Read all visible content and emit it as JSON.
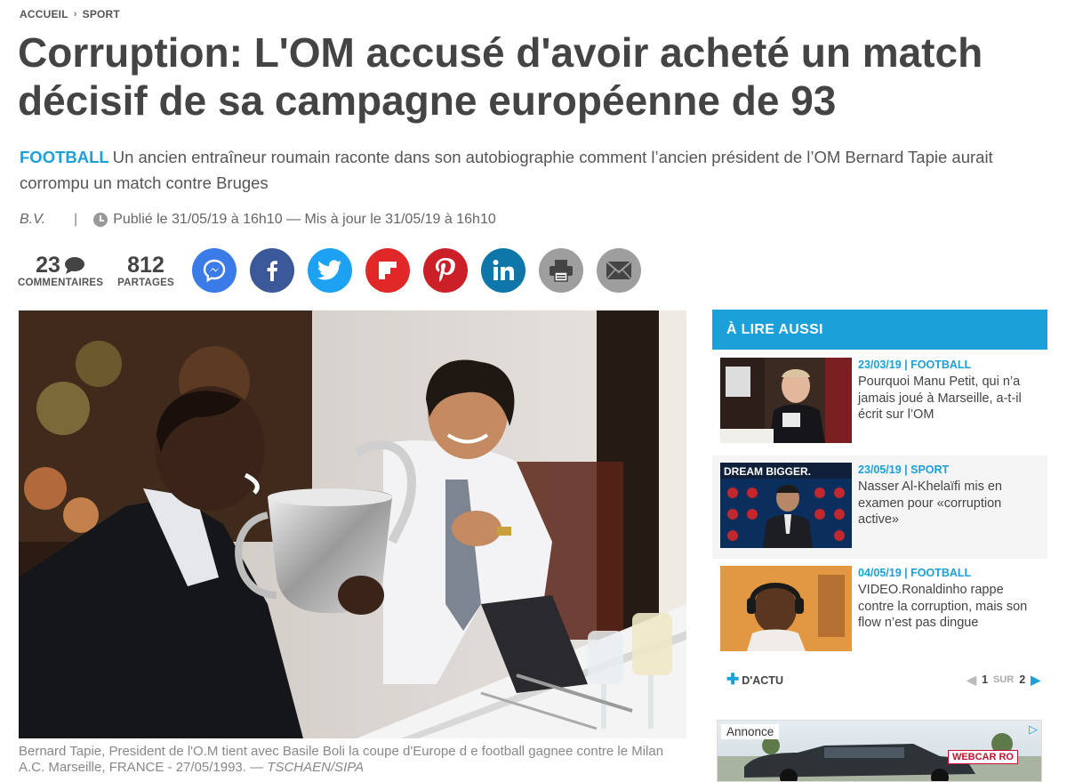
{
  "breadcrumb": {
    "home": "ACCUEIL",
    "separator": "›",
    "section": "SPORT"
  },
  "article": {
    "title": "Corruption: L'OM accusé d'avoir acheté un match décisif de sa campagne européenne de 93",
    "rubric": "FOOTBALL",
    "lead": "Un ancien entraîneur roumain raconte dans son autobiographie comment l’ancien président de l’OM Bernard Tapie aurait corrompu un match contre Bruges",
    "author": "B.V.",
    "pipe": "|",
    "published": "Publié le 31/05/19 à 16h10 — Mis à jour le 31/05/19 à 16h10"
  },
  "stats": {
    "comments_count": "23",
    "comments_label": "COMMENTAIRES",
    "shares_count": "812",
    "shares_label": "PARTAGES"
  },
  "share_buttons": [
    {
      "icon": "messenger-icon",
      "color": "#3b7be8"
    },
    {
      "icon": "facebook-icon",
      "color": "#3b5998"
    },
    {
      "icon": "twitter-icon",
      "color": "#1da1f2"
    },
    {
      "icon": "flipboard-icon",
      "color": "#e12828"
    },
    {
      "icon": "pinterest-icon",
      "color": "#cb2027"
    },
    {
      "icon": "linkedin-icon",
      "color": "#0e76a8"
    },
    {
      "icon": "print-icon",
      "color": "#9e9e9e"
    },
    {
      "icon": "mail-icon",
      "color": "#9e9e9e"
    }
  ],
  "photo": {
    "caption": "Bernard Tapie, President de l'O.M tient avec Basile Boli la coupe d'Europe d e football gagnee contre le Milan A.C. Marseille, FRANCE - 27/05/1993.",
    "credit": "— TSCHAEN/SIPA"
  },
  "aside": {
    "heading": "À LIRE AUSSI",
    "items": [
      {
        "meta": "23/03/19 | FOOTBALL",
        "title": "Pourquoi Manu Petit, qui n’a jamais joué à Marseille, a-t-il écrit sur l’OM"
      },
      {
        "meta": "23/05/19 | SPORT",
        "title": "Nasser Al-Khelaïfi mis en examen pour «corruption active»",
        "thumb_text": "DREAM BIGGER."
      },
      {
        "meta": "04/05/19 | FOOTBALL",
        "title": "VIDEO.Ronaldinho rappe contre la corruption, mais son flow n’est pas dingue"
      }
    ],
    "footer_label": "D'ACTU",
    "page_current": "1",
    "page_sur": "SUR",
    "page_total": "2"
  },
  "ad": {
    "label": "Annonce",
    "brand": "WEBCAR RO"
  },
  "colors": {
    "accent": "#1ba0d9",
    "text": "#444444"
  }
}
